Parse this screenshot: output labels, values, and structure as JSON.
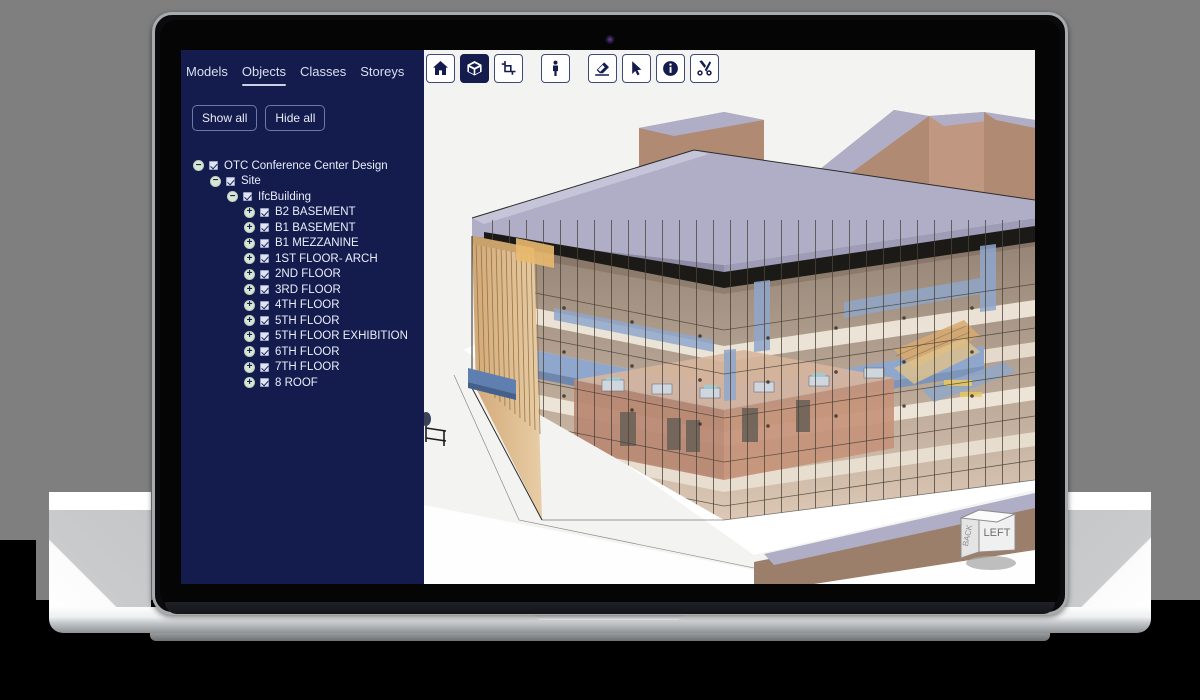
{
  "app": {
    "sidebar": {
      "tabs": [
        {
          "label": "Models",
          "active": false
        },
        {
          "label": "Objects",
          "active": true
        },
        {
          "label": "Classes",
          "active": false
        },
        {
          "label": "Storeys",
          "active": false
        }
      ],
      "buttons": {
        "show_all": "Show all",
        "hide_all": "Hide all"
      },
      "tree": [
        {
          "label": "OTC Conference Center Design",
          "depth": 0,
          "toggle": "−",
          "checked": true
        },
        {
          "label": "Site",
          "depth": 1,
          "toggle": "−",
          "checked": true
        },
        {
          "label": "IfcBuilding",
          "depth": 2,
          "toggle": "−",
          "checked": true
        },
        {
          "label": "B2 BASEMENT",
          "depth": 3,
          "toggle": "+",
          "checked": true
        },
        {
          "label": "B1 BASEMENT",
          "depth": 3,
          "toggle": "+",
          "checked": true
        },
        {
          "label": "B1 MEZZANINE",
          "depth": 3,
          "toggle": "+",
          "checked": true
        },
        {
          "label": "1ST FLOOR- ARCH",
          "depth": 3,
          "toggle": "+",
          "checked": true
        },
        {
          "label": "2ND FLOOR",
          "depth": 3,
          "toggle": "+",
          "checked": true
        },
        {
          "label": "3RD FLOOR",
          "depth": 3,
          "toggle": "+",
          "checked": true
        },
        {
          "label": "4TH FLOOR",
          "depth": 3,
          "toggle": "+",
          "checked": true
        },
        {
          "label": "5TH FLOOR",
          "depth": 3,
          "toggle": "+",
          "checked": true
        },
        {
          "label": "5TH FLOOR EXHIBITION",
          "depth": 3,
          "toggle": "+",
          "checked": true
        },
        {
          "label": "6TH FLOOR",
          "depth": 3,
          "toggle": "+",
          "checked": true
        },
        {
          "label": "7TH FLOOR",
          "depth": 3,
          "toggle": "+",
          "checked": true
        },
        {
          "label": "8 ROOF",
          "depth": 3,
          "toggle": "+",
          "checked": true
        }
      ]
    },
    "toolbar": [
      {
        "icon": "home-icon",
        "active": false,
        "separator": false
      },
      {
        "icon": "cube-icon",
        "active": true,
        "separator": false
      },
      {
        "icon": "section-plane-icon",
        "active": false,
        "separator": false
      },
      {
        "icon": "first-person-icon",
        "active": false,
        "separator": true
      },
      {
        "icon": "eraser-icon",
        "active": false,
        "separator": true
      },
      {
        "icon": "cursor-arrow-icon",
        "active": false,
        "separator": false
      },
      {
        "icon": "info-icon",
        "active": false,
        "separator": false
      },
      {
        "icon": "scissors-icon",
        "active": false,
        "separator": false
      }
    ],
    "navcube": {
      "front_face": "LEFT",
      "side_face": "BACK"
    },
    "colors": {
      "sidebar_bg": "#141c4e",
      "accent": "#c9d1e6",
      "viewport_bg": "#f2f2f0",
      "model_roof": "#b0aec6",
      "model_brick": "#b98872",
      "model_glass": "#d9bb96",
      "model_rail": "#8fa7cc",
      "model_slab": "#e8e2d8"
    }
  }
}
